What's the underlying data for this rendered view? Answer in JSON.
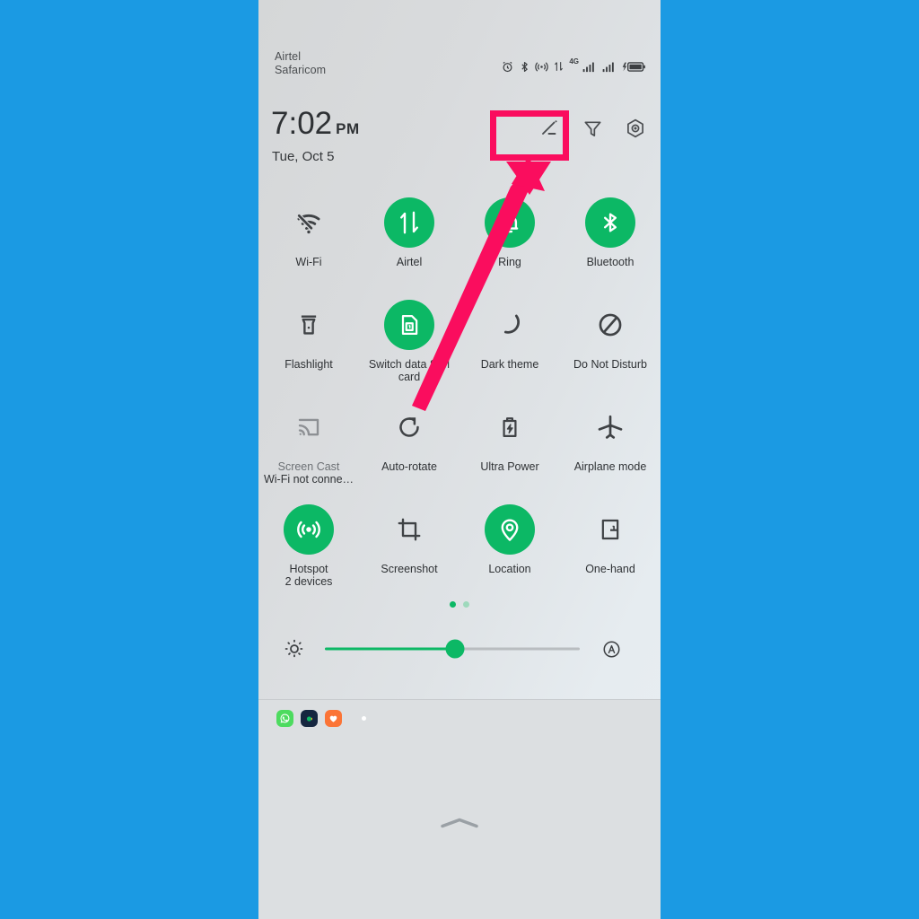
{
  "colors": {
    "background": "#1b9ae3",
    "accent_green": "#0cb865",
    "highlight_pink": "#fa0d5e",
    "text_dark": "#2f3235"
  },
  "statusbar": {
    "carrier_line1": "Airtel",
    "carrier_line2": "Safaricom",
    "icons": [
      "alarm-icon",
      "bluetooth-icon",
      "hotspot-icon",
      "data-transfer-icon",
      "signal-4g-icon",
      "signal-bars-icon",
      "battery-charging-icon"
    ],
    "network_label": "4G"
  },
  "header": {
    "time": "7:02",
    "ampm": "PM",
    "date": "Tue, Oct 5",
    "actions": [
      {
        "name": "edit-button",
        "icon": "pencil-icon",
        "highlighted": true
      },
      {
        "name": "filter-button",
        "icon": "filter-icon",
        "highlighted": false
      },
      {
        "name": "settings-button",
        "icon": "gear-hexagon-icon",
        "highlighted": false
      }
    ]
  },
  "tiles": [
    {
      "label": "Wi-Fi",
      "sub": "",
      "icon": "wifi-off-icon",
      "on": false,
      "dim": false
    },
    {
      "label": "Airtel",
      "sub": "",
      "icon": "mobile-data-icon",
      "on": true,
      "dim": false
    },
    {
      "label": "Ring",
      "sub": "",
      "icon": "bell-icon",
      "on": true,
      "dim": false
    },
    {
      "label": "Bluetooth",
      "sub": "",
      "icon": "bluetooth-icon",
      "on": true,
      "dim": false
    },
    {
      "label": "Flashlight",
      "sub": "",
      "icon": "flashlight-icon",
      "on": false,
      "dim": false
    },
    {
      "label": "Switch data SIM card",
      "sub": "",
      "icon": "sim-card-1-icon",
      "on": true,
      "dim": false
    },
    {
      "label": "Dark theme",
      "sub": "",
      "icon": "moon-icon",
      "on": false,
      "dim": false
    },
    {
      "label": "Do Not Disturb",
      "sub": "",
      "icon": "do-not-disturb-icon",
      "on": false,
      "dim": false
    },
    {
      "label": "Screen Cast",
      "sub": "Wi-Fi not conne…",
      "icon": "screen-cast-icon",
      "on": false,
      "dim": true
    },
    {
      "label": "Auto-rotate",
      "sub": "",
      "icon": "auto-rotate-icon",
      "on": false,
      "dim": false
    },
    {
      "label": "Ultra Power",
      "sub": "",
      "icon": "battery-bolt-icon",
      "on": false,
      "dim": false
    },
    {
      "label": "Airplane mode",
      "sub": "",
      "icon": "airplane-icon",
      "on": false,
      "dim": false
    },
    {
      "label": "Hotspot",
      "sub": "2 devices",
      "icon": "hotspot-waves-icon",
      "on": true,
      "dim": false
    },
    {
      "label": "Screenshot",
      "sub": "",
      "icon": "crop-icon",
      "on": false,
      "dim": false
    },
    {
      "label": "Location",
      "sub": "",
      "icon": "location-pin-icon",
      "on": true,
      "dim": false
    },
    {
      "label": "One-hand",
      "sub": "",
      "icon": "one-hand-icon",
      "on": false,
      "dim": false
    }
  ],
  "pager": {
    "pages": 2,
    "current": 1
  },
  "brightness": {
    "left_icon": "brightness-sun-icon",
    "right_icon": "auto-brightness-icon",
    "value_percent": 51
  },
  "notifications": {
    "apps": [
      {
        "name": "whatsapp-icon",
        "color": "#4ddb5f"
      },
      {
        "name": "dark-app-icon",
        "color": "#15263f"
      },
      {
        "name": "heart-app-icon",
        "color": "#fb7436"
      }
    ],
    "overflow_indicator": "more-dot"
  },
  "bottom": {
    "handle_icon": "chevron-up-handle"
  },
  "annotation": {
    "highlight_target": "edit-button",
    "arrow_from": "auto-rotate-tile",
    "arrow_to": "edit-button"
  }
}
